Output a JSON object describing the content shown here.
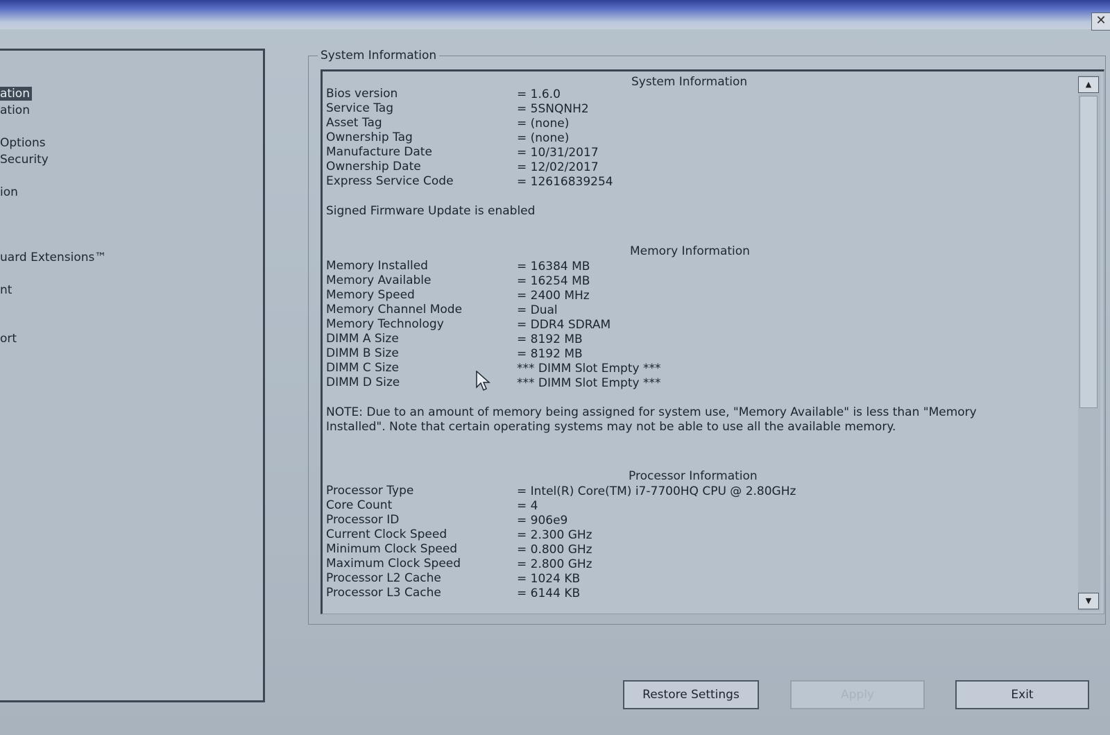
{
  "window": {
    "close_glyph": "✕"
  },
  "nav": {
    "items": [
      {
        "label": "ation",
        "selected": true
      },
      {
        "label": "ation"
      },
      {
        "label": " Options"
      },
      {
        "label": " Security"
      },
      {
        "label": "ion"
      },
      {
        "label": "uard Extensions™"
      },
      {
        "label": "nt"
      },
      {
        "label": "ort"
      }
    ]
  },
  "group": {
    "title": "System Information"
  },
  "info": {
    "system_heading": "System Information",
    "system_rows": [
      {
        "label": "Bios version",
        "value": "= 1.6.0"
      },
      {
        "label": "Service Tag",
        "value": "= 5SNQNH2"
      },
      {
        "label": "Asset Tag",
        "value": "= (none)"
      },
      {
        "label": "Ownership Tag",
        "value": "= (none)"
      },
      {
        "label": "Manufacture Date",
        "value": "= 10/31/2017"
      },
      {
        "label": "Ownership Date",
        "value": "= 12/02/2017"
      },
      {
        "label": "Express Service Code",
        "value": "= 12616839254"
      }
    ],
    "firmware_status": "Signed Firmware Update is enabled",
    "memory_heading": "Memory Information",
    "memory_rows": [
      {
        "label": "Memory Installed",
        "value": "= 16384 MB"
      },
      {
        "label": "Memory Available",
        "value": "= 16254 MB"
      },
      {
        "label": "Memory Speed",
        "value": "= 2400 MHz"
      },
      {
        "label": "Memory Channel Mode",
        "value": "= Dual"
      },
      {
        "label": "Memory Technology",
        "value": "= DDR4 SDRAM"
      },
      {
        "label": "DIMM A Size",
        "value": "= 8192 MB"
      },
      {
        "label": "DIMM B Size",
        "value": "= 8192 MB"
      },
      {
        "label": "DIMM C Size",
        "value": "*** DIMM Slot Empty ***"
      },
      {
        "label": "DIMM D Size",
        "value": "*** DIMM Slot Empty ***"
      }
    ],
    "memory_note": "NOTE: Due to an amount of memory being assigned for system use, \"Memory Available\" is less than \"Memory Installed\". Note that certain operating systems may not be able to use all the available memory.",
    "processor_heading": "Processor Information",
    "processor_rows": [
      {
        "label": "Processor Type",
        "value": "= Intel(R) Core(TM) i7-7700HQ CPU @ 2.80GHz"
      },
      {
        "label": "Core Count",
        "value": "= 4"
      },
      {
        "label": "Processor ID",
        "value": "= 906e9"
      },
      {
        "label": "Current Clock Speed",
        "value": "= 2.300 GHz"
      },
      {
        "label": "Minimum Clock Speed",
        "value": "= 0.800 GHz"
      },
      {
        "label": "Maximum Clock Speed",
        "value": "= 2.800 GHz"
      },
      {
        "label": "Processor L2 Cache",
        "value": "= 1024 KB"
      },
      {
        "label": "Processor L3 Cache",
        "value": "= 6144 KB"
      }
    ]
  },
  "scroll": {
    "up_glyph": "▲",
    "down_glyph": "▼"
  },
  "buttons": {
    "restore": "Restore Settings",
    "apply": "Apply",
    "exit": "Exit"
  }
}
